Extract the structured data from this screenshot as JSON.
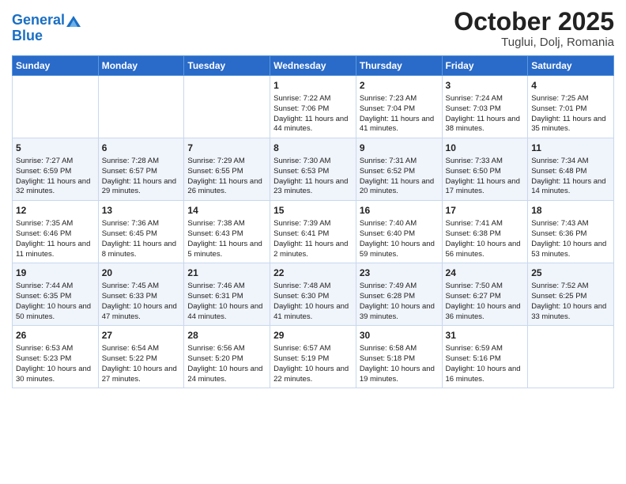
{
  "header": {
    "logo_line1": "General",
    "logo_line2": "Blue",
    "month": "October 2025",
    "location": "Tuglui, Dolj, Romania"
  },
  "days_of_week": [
    "Sunday",
    "Monday",
    "Tuesday",
    "Wednesday",
    "Thursday",
    "Friday",
    "Saturday"
  ],
  "weeks": [
    [
      {
        "day": "",
        "content": ""
      },
      {
        "day": "",
        "content": ""
      },
      {
        "day": "",
        "content": ""
      },
      {
        "day": "1",
        "content": "Sunrise: 7:22 AM\nSunset: 7:06 PM\nDaylight: 11 hours\nand 44 minutes."
      },
      {
        "day": "2",
        "content": "Sunrise: 7:23 AM\nSunset: 7:04 PM\nDaylight: 11 hours\nand 41 minutes."
      },
      {
        "day": "3",
        "content": "Sunrise: 7:24 AM\nSunset: 7:03 PM\nDaylight: 11 hours\nand 38 minutes."
      },
      {
        "day": "4",
        "content": "Sunrise: 7:25 AM\nSunset: 7:01 PM\nDaylight: 11 hours\nand 35 minutes."
      }
    ],
    [
      {
        "day": "5",
        "content": "Sunrise: 7:27 AM\nSunset: 6:59 PM\nDaylight: 11 hours\nand 32 minutes."
      },
      {
        "day": "6",
        "content": "Sunrise: 7:28 AM\nSunset: 6:57 PM\nDaylight: 11 hours\nand 29 minutes."
      },
      {
        "day": "7",
        "content": "Sunrise: 7:29 AM\nSunset: 6:55 PM\nDaylight: 11 hours\nand 26 minutes."
      },
      {
        "day": "8",
        "content": "Sunrise: 7:30 AM\nSunset: 6:53 PM\nDaylight: 11 hours\nand 23 minutes."
      },
      {
        "day": "9",
        "content": "Sunrise: 7:31 AM\nSunset: 6:52 PM\nDaylight: 11 hours\nand 20 minutes."
      },
      {
        "day": "10",
        "content": "Sunrise: 7:33 AM\nSunset: 6:50 PM\nDaylight: 11 hours\nand 17 minutes."
      },
      {
        "day": "11",
        "content": "Sunrise: 7:34 AM\nSunset: 6:48 PM\nDaylight: 11 hours\nand 14 minutes."
      }
    ],
    [
      {
        "day": "12",
        "content": "Sunrise: 7:35 AM\nSunset: 6:46 PM\nDaylight: 11 hours\nand 11 minutes."
      },
      {
        "day": "13",
        "content": "Sunrise: 7:36 AM\nSunset: 6:45 PM\nDaylight: 11 hours\nand 8 minutes."
      },
      {
        "day": "14",
        "content": "Sunrise: 7:38 AM\nSunset: 6:43 PM\nDaylight: 11 hours\nand 5 minutes."
      },
      {
        "day": "15",
        "content": "Sunrise: 7:39 AM\nSunset: 6:41 PM\nDaylight: 11 hours\nand 2 minutes."
      },
      {
        "day": "16",
        "content": "Sunrise: 7:40 AM\nSunset: 6:40 PM\nDaylight: 10 hours\nand 59 minutes."
      },
      {
        "day": "17",
        "content": "Sunrise: 7:41 AM\nSunset: 6:38 PM\nDaylight: 10 hours\nand 56 minutes."
      },
      {
        "day": "18",
        "content": "Sunrise: 7:43 AM\nSunset: 6:36 PM\nDaylight: 10 hours\nand 53 minutes."
      }
    ],
    [
      {
        "day": "19",
        "content": "Sunrise: 7:44 AM\nSunset: 6:35 PM\nDaylight: 10 hours\nand 50 minutes."
      },
      {
        "day": "20",
        "content": "Sunrise: 7:45 AM\nSunset: 6:33 PM\nDaylight: 10 hours\nand 47 minutes."
      },
      {
        "day": "21",
        "content": "Sunrise: 7:46 AM\nSunset: 6:31 PM\nDaylight: 10 hours\nand 44 minutes."
      },
      {
        "day": "22",
        "content": "Sunrise: 7:48 AM\nSunset: 6:30 PM\nDaylight: 10 hours\nand 41 minutes."
      },
      {
        "day": "23",
        "content": "Sunrise: 7:49 AM\nSunset: 6:28 PM\nDaylight: 10 hours\nand 39 minutes."
      },
      {
        "day": "24",
        "content": "Sunrise: 7:50 AM\nSunset: 6:27 PM\nDaylight: 10 hours\nand 36 minutes."
      },
      {
        "day": "25",
        "content": "Sunrise: 7:52 AM\nSunset: 6:25 PM\nDaylight: 10 hours\nand 33 minutes."
      }
    ],
    [
      {
        "day": "26",
        "content": "Sunrise: 6:53 AM\nSunset: 5:23 PM\nDaylight: 10 hours\nand 30 minutes."
      },
      {
        "day": "27",
        "content": "Sunrise: 6:54 AM\nSunset: 5:22 PM\nDaylight: 10 hours\nand 27 minutes."
      },
      {
        "day": "28",
        "content": "Sunrise: 6:56 AM\nSunset: 5:20 PM\nDaylight: 10 hours\nand 24 minutes."
      },
      {
        "day": "29",
        "content": "Sunrise: 6:57 AM\nSunset: 5:19 PM\nDaylight: 10 hours\nand 22 minutes."
      },
      {
        "day": "30",
        "content": "Sunrise: 6:58 AM\nSunset: 5:18 PM\nDaylight: 10 hours\nand 19 minutes."
      },
      {
        "day": "31",
        "content": "Sunrise: 6:59 AM\nSunset: 5:16 PM\nDaylight: 10 hours\nand 16 minutes."
      },
      {
        "day": "",
        "content": ""
      }
    ]
  ]
}
